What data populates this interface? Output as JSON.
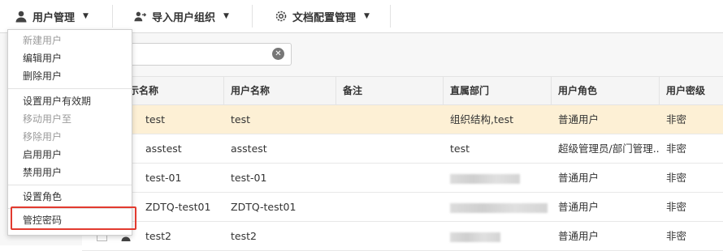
{
  "toolbar": {
    "user_mgmt": "用户管理",
    "import_org": "导入用户组织",
    "doc_config": "文档配置管理"
  },
  "search": {
    "value": "test"
  },
  "table": {
    "headers": [
      "示名称",
      "用户名称",
      "备注",
      "直属部门",
      "用户角色",
      "用户密级"
    ],
    "rows": [
      {
        "name": "test",
        "username": "test",
        "note": "",
        "dept": "组织结构,test",
        "role": "普通用户",
        "level": "非密",
        "dept_blurred": false
      },
      {
        "name": "asstest",
        "username": "asstest",
        "note": "",
        "dept": "test",
        "role": "超级管理员/部门管理...",
        "level": "非密",
        "dept_blurred": false
      },
      {
        "name": "test-01",
        "username": "test-01",
        "note": "",
        "dept": "",
        "role": "普通用户",
        "level": "非密",
        "dept_blurred": true
      },
      {
        "name": "ZDTQ-test01",
        "username": "ZDTQ-test01",
        "note": "",
        "dept": "",
        "role": "普通用户",
        "level": "非密",
        "dept_blurred": true
      },
      {
        "name": "test2",
        "username": "test2",
        "note": "",
        "dept": "",
        "role": "普通用户",
        "level": "非密",
        "dept_blurred": true
      }
    ]
  },
  "menu": {
    "items": [
      {
        "label": "新建用户",
        "disabled": true
      },
      {
        "label": "编辑用户",
        "disabled": false
      },
      {
        "label": "删除用户",
        "disabled": false
      },
      {
        "label": "设置用户有效期",
        "disabled": false
      },
      {
        "label": "移动用户至",
        "disabled": true
      },
      {
        "label": "移除用户",
        "disabled": true
      },
      {
        "label": "启用用户",
        "disabled": false
      },
      {
        "label": "禁用用户",
        "disabled": false
      },
      {
        "label": "设置角色",
        "disabled": false
      },
      {
        "label": "管控密码",
        "disabled": false
      }
    ]
  },
  "colors": {
    "highlight": "#e23a2f",
    "selected_row": "#fdf0d5"
  }
}
